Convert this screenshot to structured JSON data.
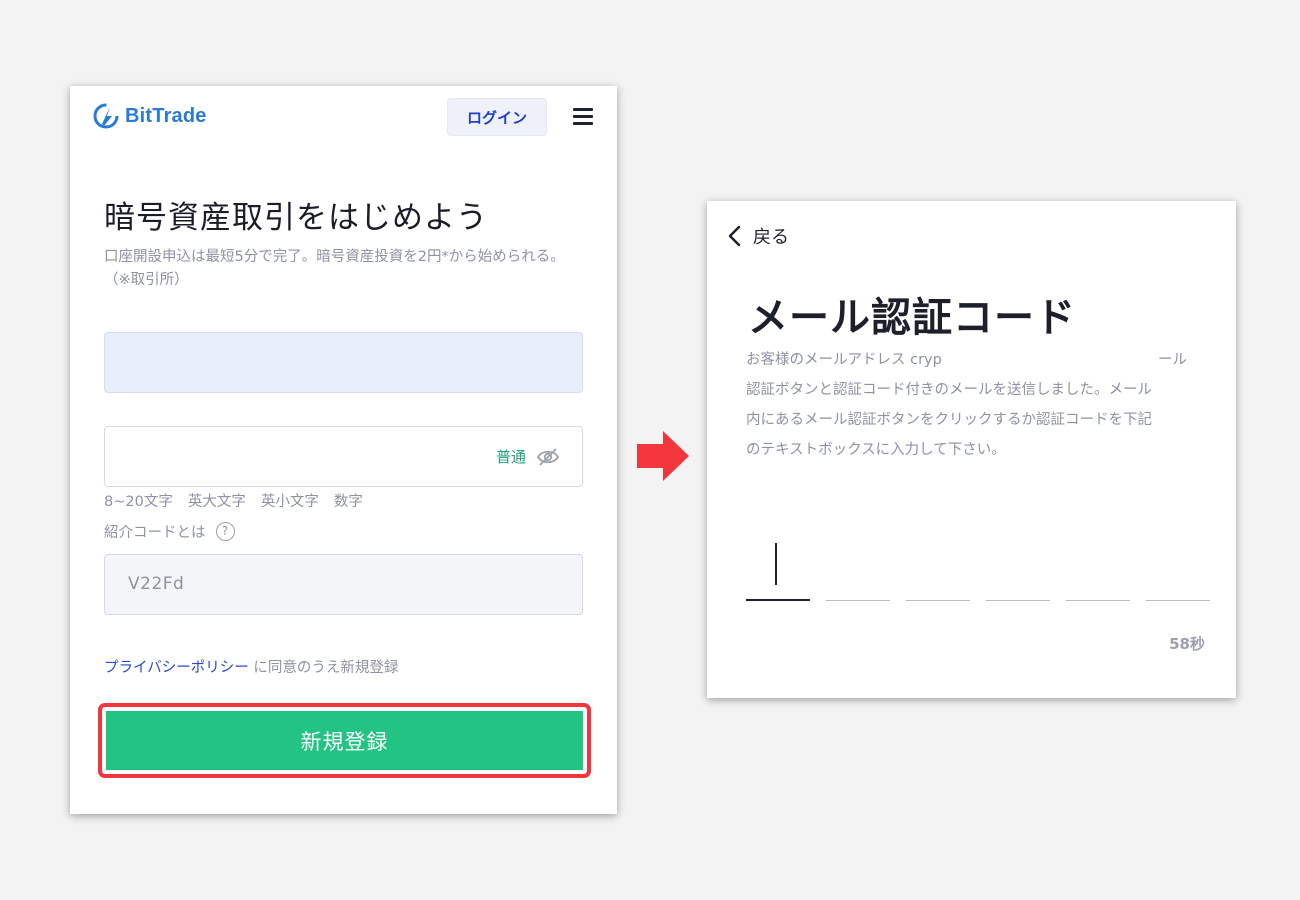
{
  "left_screen": {
    "header": {
      "logo_text": "BitTrade",
      "logo_icon": "bittrade-logo-icon",
      "login_label": "ログイン",
      "menu_icon": "hamburger-menu-icon"
    },
    "title": "暗号資産取引をはじめよう",
    "subtitle": "口座開設申込は最短5分で完了。暗号資産投資を2円*から始められる。（※取引所）",
    "email_field": {
      "value": ""
    },
    "password_field": {
      "value": "",
      "strength": "普通",
      "toggle_icon": "eye-off-icon"
    },
    "password_rules": [
      "8~20文字",
      "英大文字",
      "英小文字",
      "数字"
    ],
    "referral": {
      "label": "紹介コードとは",
      "help_icon": "question-circle-icon",
      "value": "V22Fd"
    },
    "privacy": {
      "link": "プライバシーポリシー",
      "text": " に同意のうえ新規登録"
    },
    "signup_button": "新規登録"
  },
  "arrow_icon": "right-arrow-icon",
  "right_screen": {
    "back_label": "戻る",
    "back_icon": "chevron-left-icon",
    "title": "メール認証コード",
    "description": {
      "line1_start": "お客様のメールアドレス cryp",
      "line1_end": "ール",
      "line2": "認証ボタンと認証コード付きのメールを送信しました。メール",
      "line3": "内にあるメール認証ボタンをクリックするか認証コードを下記",
      "line4": "のテキストボックスに入力して下さい。"
    },
    "code_digits": [
      "",
      "",
      "",
      "",
      "",
      ""
    ],
    "timer": "58秒"
  },
  "colors": {
    "brand_blue": "#2a7bd8",
    "signup_green": "#23c483",
    "highlight_red": "#f2363c",
    "link_blue": "#2a49d0",
    "strength_green": "#1fa27a"
  }
}
